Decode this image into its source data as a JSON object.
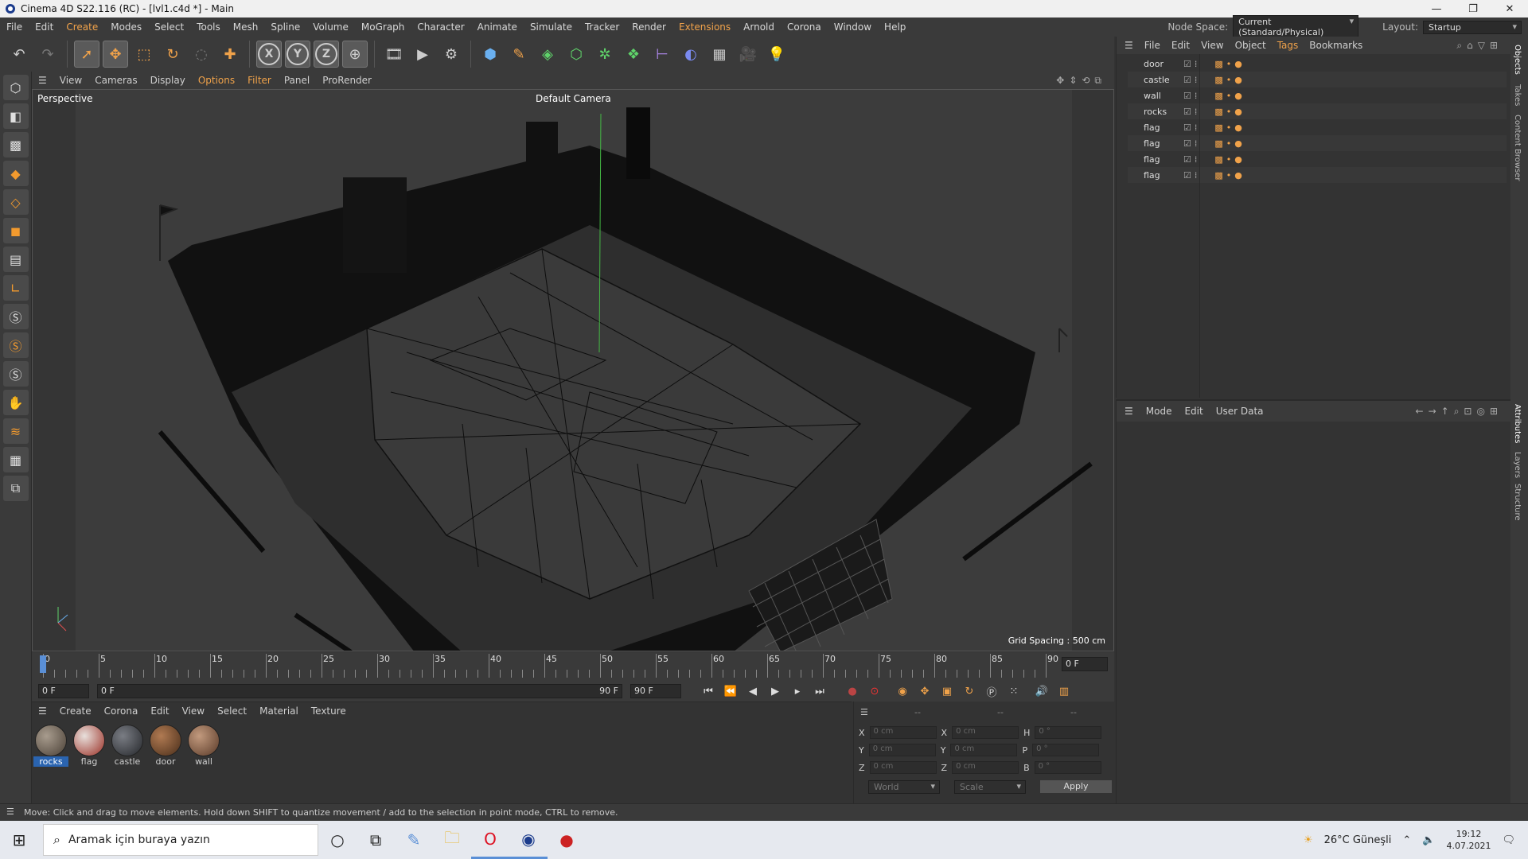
{
  "window": {
    "title": "Cinema 4D S22.116 (RC) - [lvl1.c4d *] - Main",
    "controls": [
      "—",
      "❐",
      "✕"
    ]
  },
  "menubar": {
    "items": [
      "File",
      "Edit",
      "Create",
      "Modes",
      "Select",
      "Tools",
      "Mesh",
      "Spline",
      "Volume",
      "MoGraph",
      "Character",
      "Animate",
      "Simulate",
      "Tracker",
      "Render",
      "Extensions",
      "Arnold",
      "Corona",
      "Window",
      "Help"
    ],
    "node_space_label": "Node Space:",
    "node_space_value": "Current (Standard/Physical)",
    "layout_label": "Layout:",
    "layout_value": "Startup"
  },
  "viewport_menu": {
    "items": [
      "View",
      "Cameras",
      "Display",
      "Options",
      "Filter",
      "Panel",
      "ProRender"
    ]
  },
  "viewport": {
    "projection": "Perspective",
    "camera": "Default Camera",
    "grid_spacing": "Grid Spacing : 500 cm"
  },
  "timeline": {
    "ticks": [
      "0",
      "5",
      "10",
      "15",
      "20",
      "25",
      "30",
      "35",
      "40",
      "45",
      "50",
      "55",
      "60",
      "65",
      "70",
      "75",
      "80",
      "85",
      "90"
    ],
    "current_frame": "0 F"
  },
  "playbar": {
    "start": "0 F",
    "range_start": "0 F",
    "range_end": "90 F",
    "end": "90 F"
  },
  "material_menu": {
    "items": [
      "Create",
      "Corona",
      "Edit",
      "View",
      "Select",
      "Material",
      "Texture"
    ]
  },
  "materials": [
    {
      "name": "rocks",
      "color": "#7a7064",
      "selected": true
    },
    {
      "name": "flag",
      "color": "#b04a3a",
      "selected": false
    },
    {
      "name": "castle",
      "color": "#4b4e55",
      "selected": false
    },
    {
      "name": "door",
      "color": "#8a5a3a",
      "selected": false
    },
    {
      "name": "wall",
      "color": "#8c6a52",
      "selected": false
    }
  ],
  "coords": {
    "headers": [
      "--",
      "--",
      "--"
    ],
    "rows": [
      {
        "a": "X",
        "av": "0 cm",
        "b": "X",
        "bv": "0 cm",
        "c": "H",
        "cv": "0 °"
      },
      {
        "a": "Y",
        "av": "0 cm",
        "b": "Y",
        "bv": "0 cm",
        "c": "P",
        "cv": "0 °"
      },
      {
        "a": "Z",
        "av": "0 cm",
        "b": "Z",
        "bv": "0 cm",
        "c": "B",
        "cv": "0 °"
      }
    ],
    "space": "World",
    "mode": "Scale",
    "apply": "Apply"
  },
  "object_manager": {
    "menu": [
      "File",
      "Edit",
      "View",
      "Object",
      "Tags",
      "Bookmarks"
    ],
    "objects": [
      "door",
      "castle",
      "wall",
      "rocks",
      "flag",
      "flag",
      "flag",
      "flag"
    ]
  },
  "attribute_manager": {
    "menu": [
      "Mode",
      "Edit",
      "User Data"
    ]
  },
  "side_tabs": [
    "Objects",
    "Takes",
    "Content Browser",
    "Attributes",
    "Layers",
    "Structure"
  ],
  "status": "Move: Click and drag to move elements. Hold down SHIFT to quantize movement / add to the selection in point mode, CTRL to remove.",
  "taskbar": {
    "search_placeholder": "Aramak için buraya yazın",
    "weather": "26°C Güneşli",
    "time": "19:12",
    "date": "4.07.2021"
  },
  "colors": {
    "accent": "#f0a24a",
    "selection": "#2a64b0"
  }
}
